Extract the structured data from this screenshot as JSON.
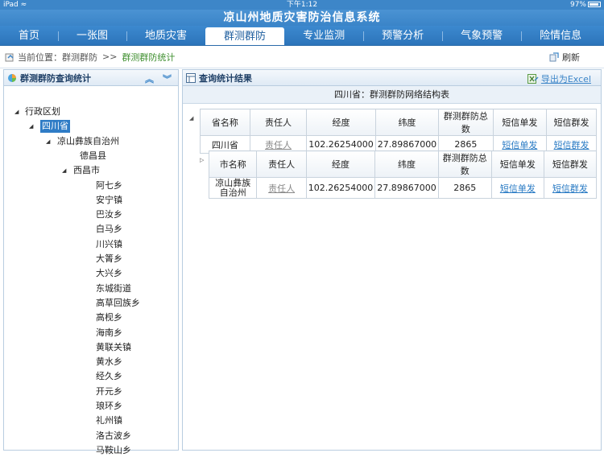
{
  "status": {
    "device": "iPad",
    "time": "下午1:12",
    "battery": "97%"
  },
  "app": {
    "title": "凉山州地质灾害防治信息系统"
  },
  "nav": [
    {
      "label": "首页",
      "active": false
    },
    {
      "label": "一张图",
      "active": false
    },
    {
      "label": "地质灾害",
      "active": false
    },
    {
      "label": "群测群防",
      "active": true
    },
    {
      "label": "专业监测",
      "active": false
    },
    {
      "label": "预警分析",
      "active": false
    },
    {
      "label": "气象预警",
      "active": false
    },
    {
      "label": "险情信息",
      "active": false
    }
  ],
  "breadcrumb": {
    "prefix": "当前位置：",
    "parent": "群测群防",
    "sep": ">>",
    "current": "群测群防统计"
  },
  "refresh_label": "刷新",
  "left_panel": {
    "title": "群测群防查询统计"
  },
  "tree": [
    {
      "label": "行政区划",
      "toggle": "◢"
    },
    {
      "label": "四川省",
      "toggle": "◢",
      "selected": true
    },
    {
      "label": "凉山彝族自治州",
      "toggle": "◢"
    },
    {
      "label": "德昌县",
      "toggle": ""
    },
    {
      "label": "西昌市",
      "toggle": "◢"
    },
    {
      "label": "阿七乡"
    },
    {
      "label": "安宁镇"
    },
    {
      "label": "巴汝乡"
    },
    {
      "label": "白马乡"
    },
    {
      "label": "川兴镇"
    },
    {
      "label": "大箐乡"
    },
    {
      "label": "大兴乡"
    },
    {
      "label": "东城街道"
    },
    {
      "label": "高草回族乡"
    },
    {
      "label": "高枧乡"
    },
    {
      "label": "海南乡"
    },
    {
      "label": "黄联关镇"
    },
    {
      "label": "黄水乡"
    },
    {
      "label": "经久乡"
    },
    {
      "label": "开元乡"
    },
    {
      "label": "琅环乡"
    },
    {
      "label": "礼州镇"
    },
    {
      "label": "洛古波乡"
    },
    {
      "label": "马鞍山乡"
    }
  ],
  "right_panel": {
    "title": "查询统计结果",
    "export_label": "导出为Excel",
    "subtitle": "四川省：群测群防网络结构表"
  },
  "province_table": {
    "headers": [
      "省名称",
      "责任人",
      "经度",
      "纬度",
      "群测群防总数",
      "短信单发",
      "短信群发"
    ],
    "row": [
      "四川省",
      "责任人",
      "102.26254000",
      "27.89867000",
      "2865",
      "短信单发",
      "短信群发"
    ]
  },
  "city_table": {
    "headers": [
      "市名称",
      "责任人",
      "经度",
      "纬度",
      "群测群防总数",
      "短信单发",
      "短信群发"
    ],
    "row": [
      "凉山彝族自治州",
      "责任人",
      "102.26254000",
      "27.89867000",
      "2865",
      "短信单发",
      "短信群发"
    ]
  },
  "colors": {
    "accent": "#3d86c8",
    "nav": "#2c74ba",
    "selected": "#2f7cc6",
    "current_crumb": "#3f8f2f",
    "link": "#2a7bc4"
  }
}
